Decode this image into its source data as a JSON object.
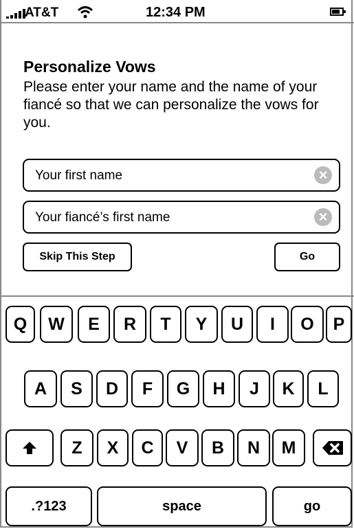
{
  "status_bar": {
    "carrier": "AT&T",
    "time": "12:34 PM",
    "signal_icon": "signal-bars-icon",
    "wifi_icon": "wifi-icon",
    "battery_icon": "battery-icon"
  },
  "header": {
    "title": "Personalize Vows",
    "description": "Please enter your name and the name of your fiancé so that we can personalize the vows for you."
  },
  "form": {
    "first_name_placeholder": "Your first name",
    "fiance_name_placeholder": "Your fiancé’s first name",
    "clear_icon": "clear-icon",
    "skip_label": "Skip This Step",
    "go_label": "Go"
  },
  "keyboard": {
    "row1": [
      "Q",
      "W",
      "E",
      "R",
      "T",
      "Y",
      "U",
      "I",
      "O",
      "P"
    ],
    "row2": [
      "A",
      "S",
      "D",
      "F",
      "G",
      "H",
      "J",
      "K",
      "L"
    ],
    "row3": [
      "Z",
      "X",
      "C",
      "V",
      "B",
      "N",
      "M"
    ],
    "numbers_label": ".?123",
    "space_label": "space",
    "go_label": "go",
    "shift_icon": "shift-icon",
    "backspace_icon": "backspace-icon"
  }
}
